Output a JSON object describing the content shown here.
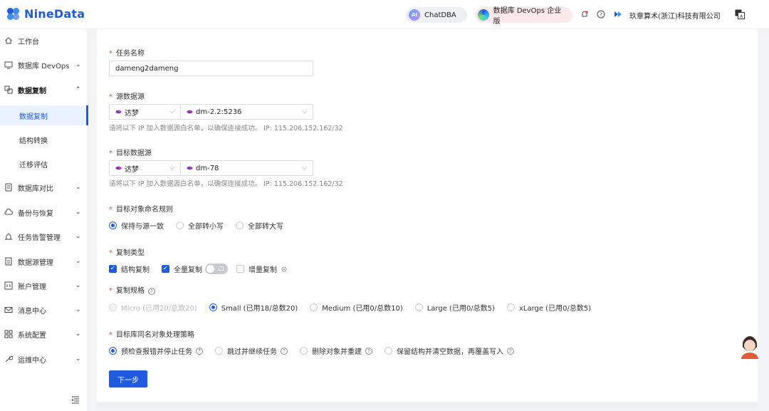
{
  "header": {
    "brand": "NineData",
    "chatdba_label": "ChatDBA",
    "chatdba_badge": "AI",
    "devops_label": "数据库 DevOps 企业版",
    "company": "玖章算术(浙江)科技有限公司"
  },
  "sidebar": {
    "items": [
      {
        "label": "工作台"
      },
      {
        "label": "数据库 DevOps"
      },
      {
        "label": "数据复制"
      },
      {
        "label": "数据复制"
      },
      {
        "label": "结构转换"
      },
      {
        "label": "迁移评估"
      },
      {
        "label": "数据库对比"
      },
      {
        "label": "备份与恢复"
      },
      {
        "label": "任务告警管理"
      },
      {
        "label": "数据源管理"
      },
      {
        "label": "账户管理"
      },
      {
        "label": "消息中心"
      },
      {
        "label": "系统配置"
      },
      {
        "label": "运维中心"
      }
    ]
  },
  "form": {
    "task_name_label": "任务名称",
    "task_name_value": "dameng2dameng",
    "source_label": "源数据源",
    "source_type": "达梦",
    "source_instance": "dm-2.2:5236",
    "source_hint": "请将以下 IP 加入数据源白名单，以确保连接成功。 IP: 115.206.152.162/32",
    "target_label": "目标数据源",
    "target_type": "达梦",
    "target_instance": "dm-78",
    "target_hint": "请将以下 IP 加入数据源白名单，以确保连接成功。 IP: 115.206.152.162/32",
    "naming_label": "目标对象命名规则",
    "naming_options": [
      "保持与源一致",
      "全部转小写",
      "全部转大写"
    ],
    "naming_selected": "保持与源一致",
    "copy_type_label": "复制类型",
    "copy_types": [
      {
        "label": "结构复制",
        "checked": true
      },
      {
        "label": "全量复制",
        "checked": true
      },
      {
        "label": "增量复制",
        "checked": false
      }
    ],
    "spec_label": "复制规格",
    "spec_options": [
      {
        "label": "Micro (已用20/总数20)",
        "disabled": true
      },
      {
        "label": "Small (已用18/总数20)",
        "selected": true
      },
      {
        "label": "Medium (已用0/总数10)"
      },
      {
        "label": "Large (已用0/总数5)"
      },
      {
        "label": "xLarge (已用0/总数5)"
      }
    ],
    "conflict_label": "目标库同名对象处理策略",
    "conflict_options": [
      "预检查报错并停止任务",
      "跳过并继续任务",
      "删除对象并重建",
      "保留结构并清空数据，再覆盖写入"
    ],
    "conflict_selected": "预检查报错并停止任务",
    "next_button": "下一步"
  },
  "colors": {
    "accent": "#1f5ae0",
    "required": "#e5484d",
    "devops_pill": "#fde9ea"
  },
  "icons": [
    "home-icon",
    "monitor-icon",
    "copy-icon",
    "compare-icon",
    "cloud-backup-icon",
    "alarm-icon",
    "datasource-icon",
    "account-icon",
    "mail-icon",
    "grid-icon",
    "wrench-icon",
    "bell-icon",
    "help-icon",
    "translate-icon"
  ]
}
